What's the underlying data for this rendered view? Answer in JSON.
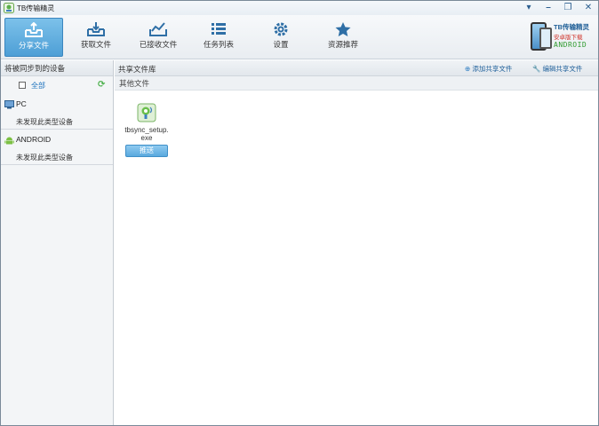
{
  "window": {
    "title": "TB传输精灵"
  },
  "toolbar": {
    "tabs": [
      {
        "label": "分享文件",
        "icon": "share-tray-icon"
      },
      {
        "label": "获取文件",
        "icon": "receive-tray-icon"
      },
      {
        "label": "已接收文件",
        "icon": "received-chart-icon"
      },
      {
        "label": "任务列表",
        "icon": "task-list-icon"
      },
      {
        "label": "设置",
        "icon": "gear-icon"
      },
      {
        "label": "资源推荐",
        "icon": "star-icon"
      }
    ],
    "active_tab": "分享文件",
    "accent_color": "#4e9fd6"
  },
  "promo": {
    "line1": "TB传输精灵",
    "line2": "安卓版下载",
    "line3": "ANDROID"
  },
  "left_panel": {
    "header": "将被同步到的设备",
    "all_label": "全部",
    "groups": [
      {
        "name": "PC",
        "empty_text": "未发现此类型设备",
        "icon": "pc-monitor-icon"
      },
      {
        "name": "ANDROID",
        "empty_text": "未发现此类型设备",
        "icon": "android-icon"
      }
    ]
  },
  "right_panel": {
    "header": "共享文件库",
    "add_link": "添加共享文件",
    "edit_link": "编辑共享文件",
    "section": "其他文件",
    "files": [
      {
        "name": "tbsync_setup.exe",
        "button": "推送"
      }
    ]
  }
}
